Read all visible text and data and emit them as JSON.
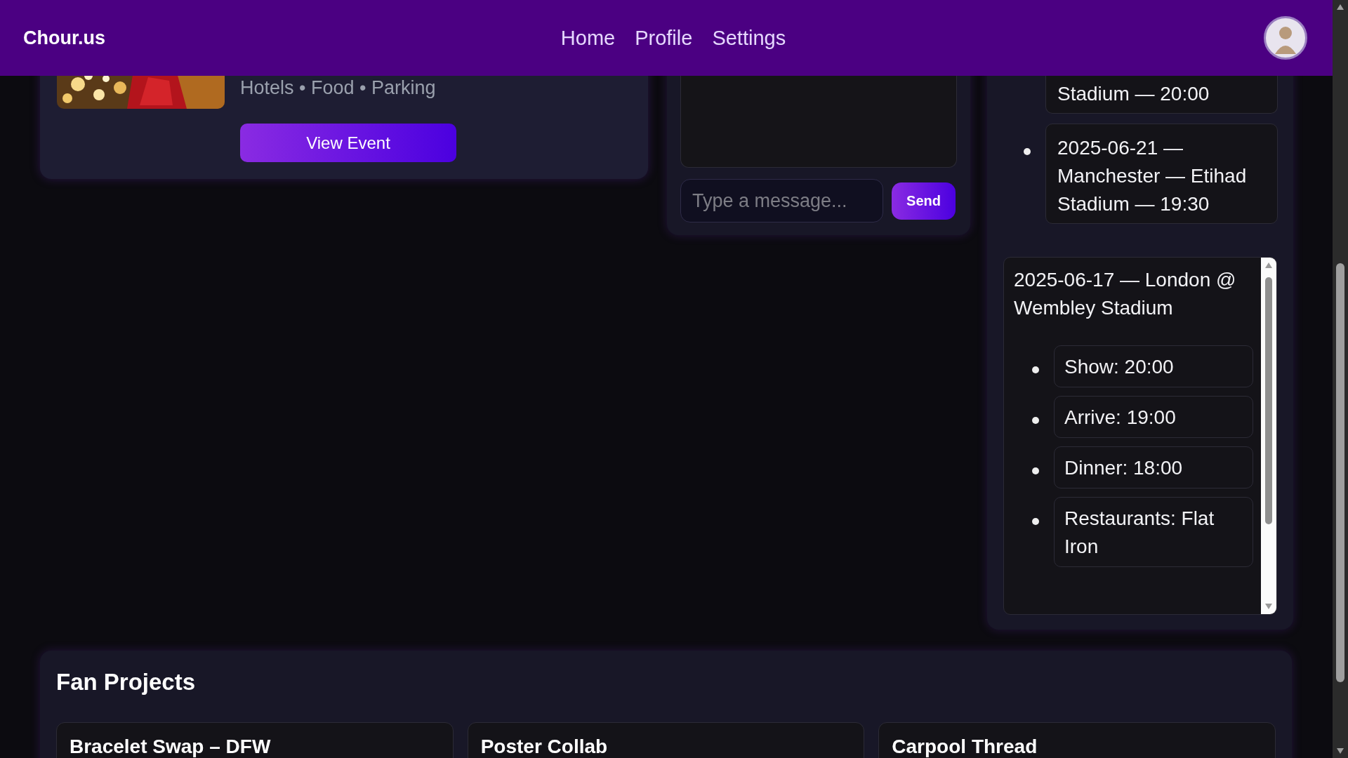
{
  "header": {
    "logo": "Chour.us",
    "nav": [
      {
        "label": "Home"
      },
      {
        "label": "Profile"
      },
      {
        "label": "Settings"
      }
    ]
  },
  "event_card": {
    "tags": "Hotels • Food • Parking",
    "button": "View Event"
  },
  "chat": {
    "input": {
      "placeholder": "Type a message..."
    },
    "send_button": "Send"
  },
  "tour_dates": {
    "items": [
      "Stadium — 20:00",
      "2025-06-21 — Manchester — Etihad Stadium — 19:30"
    ]
  },
  "itinerary": {
    "title": "2025-06-17 — London @ Wembley Stadium",
    "items": [
      "Show: 20:00",
      "Arrive: 19:00",
      "Dinner: 18:00",
      "Restaurants: Flat Iron"
    ]
  },
  "fan_projects": {
    "title": "Fan Projects",
    "projects": [
      {
        "title": "Bracelet Swap – DFW"
      },
      {
        "title": "Poster Collab"
      },
      {
        "title": "Carpool Thread"
      }
    ]
  }
}
